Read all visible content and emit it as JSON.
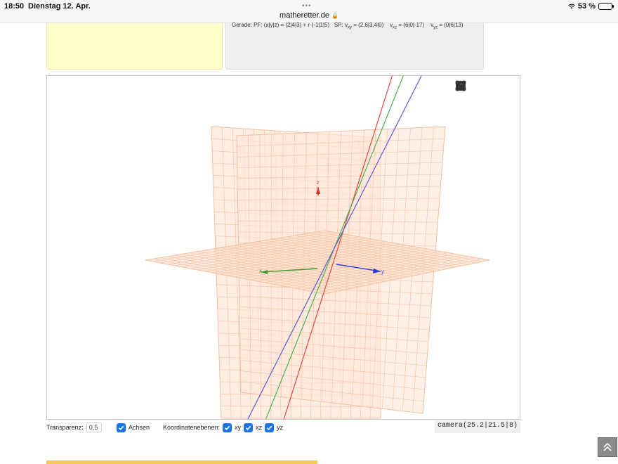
{
  "status": {
    "time": "18:50",
    "date": "Dienstag 12. Apr.",
    "url": "matheretter.de",
    "battery": "53 %"
  },
  "panel": {
    "line_label": "Gerade: PF: (x|y|z) = (2|4|3) + r·(-1|1|5)",
    "sp_label": "SP:",
    "sxy": "v",
    "sxy_sub": "xy",
    "sxy_val": " = (2,6|3,4|0)",
    "sxz": "v",
    "sxz_sub": "xz",
    "sxz_val": " = (6|0|-17)",
    "syz": "v",
    "syz_sub": "yz",
    "syz_val": " = (0|6|13)"
  },
  "viewer": {
    "axis_x": "x",
    "axis_y": "y",
    "axis_z": "z",
    "icons": [
      "rotate-icon",
      "link-icon",
      "cube-icon",
      "fullscreen-icon"
    ],
    "colors": {
      "plane": "#fde3cf",
      "grid": "#f0b89a",
      "x": "#3a9a2a",
      "y": "#2a3ad8",
      "z": "#d82a2a",
      "line_red": "#e8473f",
      "line_green": "#4caf50",
      "line_blue": "#5b5bd6"
    }
  },
  "controls": {
    "transparency_label": "Transparenz:",
    "transparency_value": "0,5",
    "axes_label": "Achsen",
    "planes_label": "Koordinatenebenen:",
    "xy_label": "xy",
    "xz_label": "xz",
    "yz_label": "yz",
    "camera": "camera(25.2|21.5|8)"
  }
}
